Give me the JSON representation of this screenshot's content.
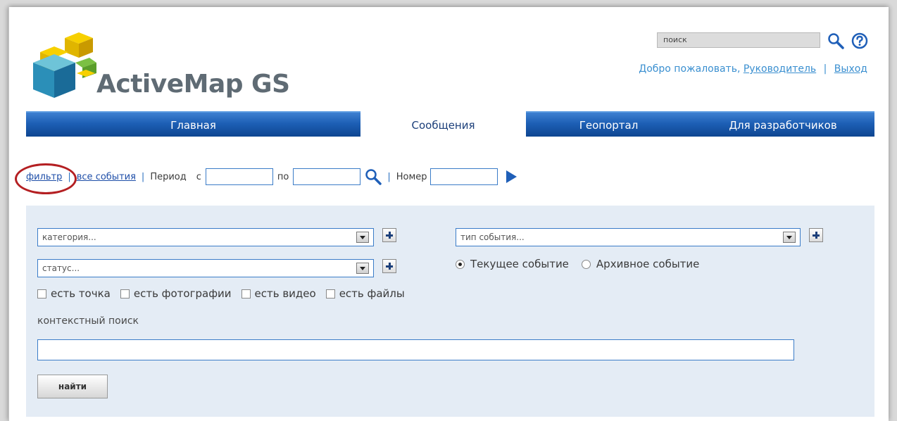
{
  "brand": {
    "name": "ActiveMap GS"
  },
  "header": {
    "search_placeholder": "поиск",
    "welcome_text": "Добро пожаловать,",
    "user_link": "Руководитель",
    "separator": "|",
    "logout_link": "Выход"
  },
  "nav": {
    "items": [
      {
        "label": "Главная"
      },
      {
        "label": "Сообщения"
      },
      {
        "label": "Геопортал"
      },
      {
        "label": "Для разработчиков"
      }
    ],
    "active": "Сообщения"
  },
  "filter_bar": {
    "filter_link": "фильтр",
    "all_events_link": "все события",
    "period_label": "Период",
    "from_label": "с",
    "to_label": "по",
    "number_label": "Номер",
    "from_value": "",
    "to_value": "",
    "number_value": ""
  },
  "panel": {
    "category_select": "категория...",
    "event_type_select": "тип события...",
    "status_select": "статус...",
    "radio_current": "Текущее событие",
    "radio_archive": "Архивное событие",
    "radio_selected": "Текущее событие",
    "checkboxes": [
      {
        "label": "есть точка"
      },
      {
        "label": "есть фотографии"
      },
      {
        "label": "есть видео"
      },
      {
        "label": "есть файлы"
      }
    ],
    "context_search_label": "контекстный поиск",
    "context_search_value": "",
    "find_button": "найти"
  },
  "colors": {
    "nav_blue": "#1d5fb5",
    "link_blue": "#1e4ea8",
    "panel_bg": "#e4ecf5",
    "highlight_red": "#b41f22"
  }
}
